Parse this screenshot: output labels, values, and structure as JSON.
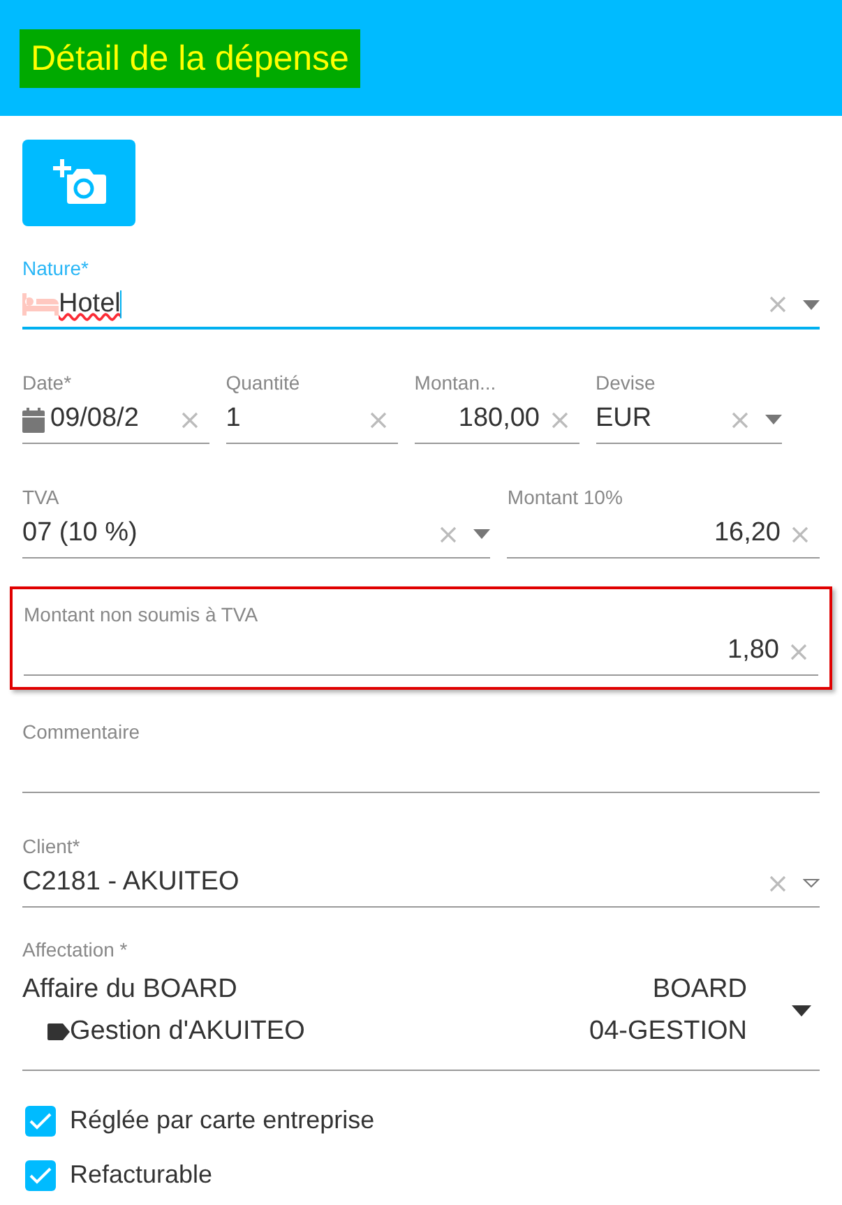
{
  "header": {
    "title": "Détail de la dépense"
  },
  "photo_button": {
    "kind": "add-photo"
  },
  "rows": [
    [
      {
        "kind": "nature",
        "label": "Nature*",
        "value": "Hotel",
        "focused": true,
        "misspelled": true
      }
    ],
    [
      {
        "kind": "date",
        "label": "Date*",
        "value": "09/08/2"
      },
      {
        "kind": "text",
        "label": "Quantité",
        "value": "1"
      },
      {
        "kind": "amount",
        "label": "Montan...",
        "value": "180,00"
      },
      {
        "kind": "select",
        "label": "Devise",
        "value": "EUR"
      }
    ],
    [
      {
        "kind": "select",
        "label": "TVA",
        "value": "07 (10 %)"
      },
      {
        "kind": "amount",
        "label": "Montant 10%",
        "value": "16,20"
      }
    ],
    [
      {
        "kind": "amount",
        "label": "Montant non soumis à TVA",
        "value": "1,80",
        "highlighted": true
      }
    ],
    [
      {
        "kind": "textarea",
        "label": "Commentaire"
      }
    ],
    [
      {
        "kind": "client",
        "label": "Client*",
        "value": "C2181 - AKUITEO"
      }
    ]
  ],
  "affectation": {
    "label": "Affectation *",
    "project": "Affaire du BOARD",
    "project_code": "BOARD",
    "task": "Gestion d'AKUITEO",
    "task_code": "04-GESTION"
  },
  "checkboxes": [
    {
      "label": "Réglée par carte entreprise",
      "checked": true
    },
    {
      "label": "Refacturable",
      "checked": true
    }
  ]
}
